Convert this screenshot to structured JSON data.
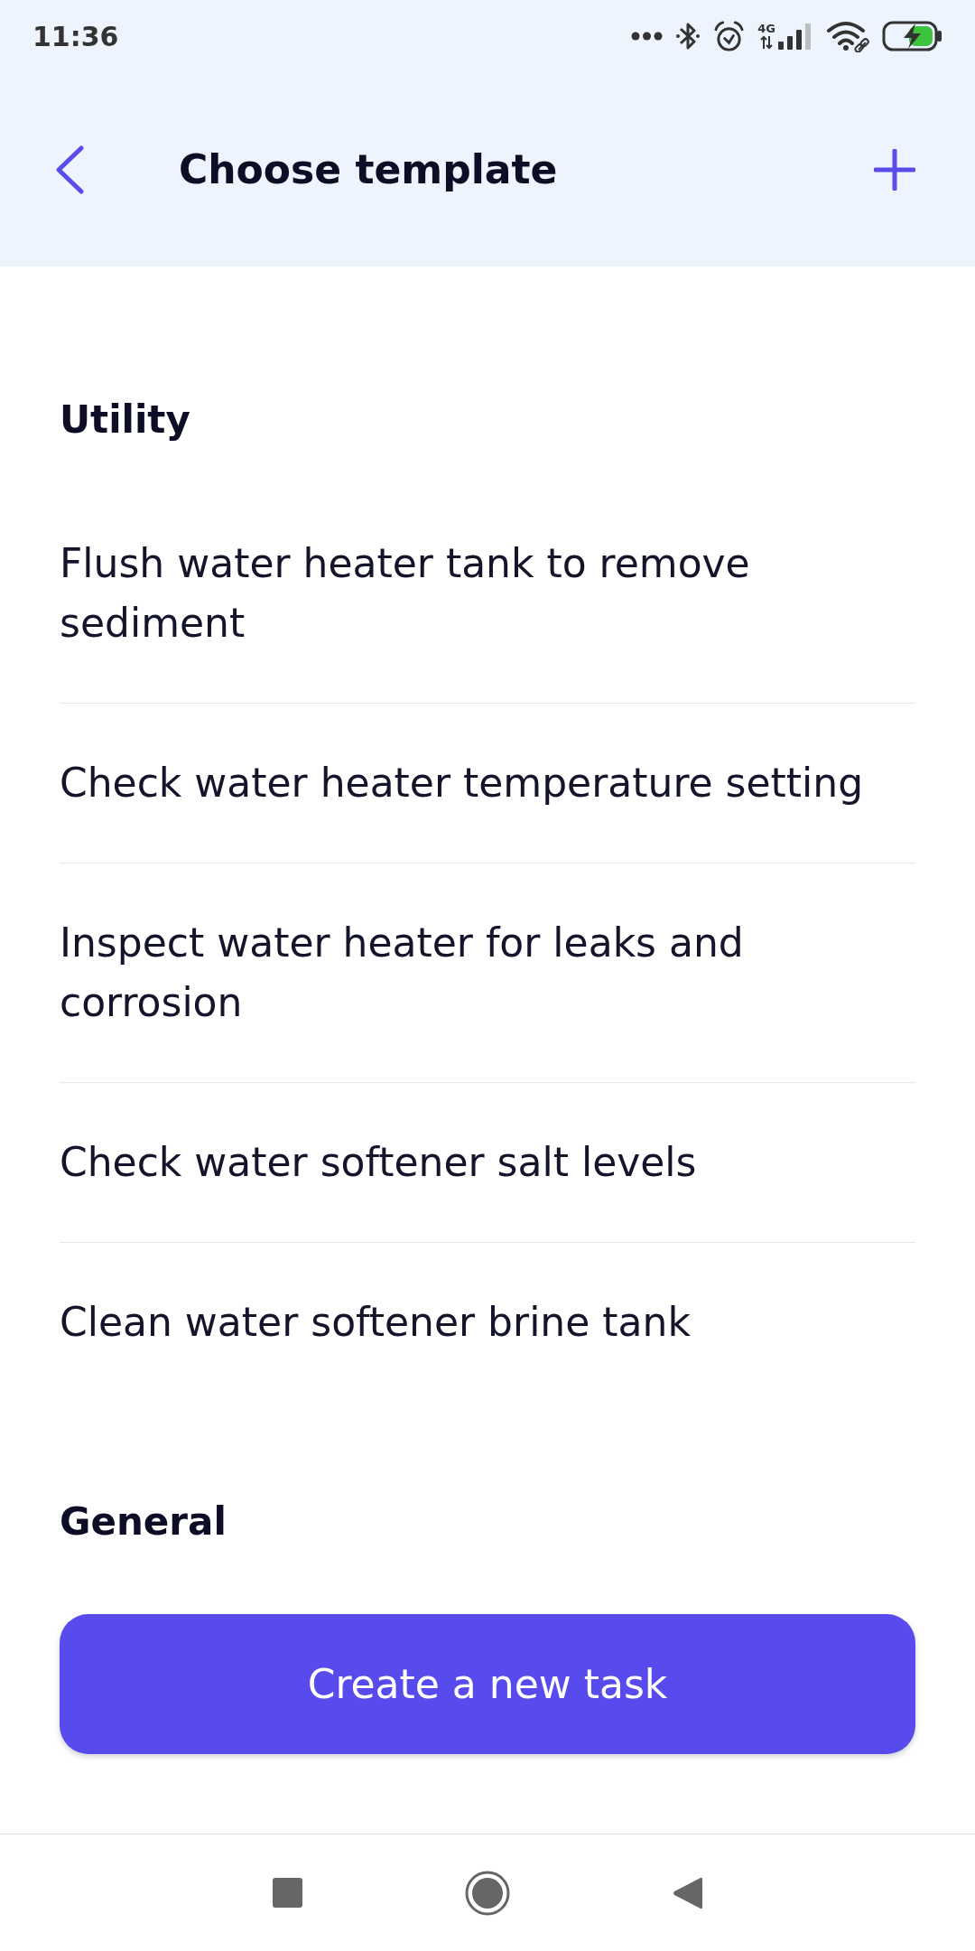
{
  "status_bar": {
    "time": "11:36",
    "network_type": "4G"
  },
  "header": {
    "title": "Choose template"
  },
  "sections": [
    {
      "title": "Utility",
      "items": [
        "Flush water heater tank to remove sediment",
        "Check water heater temperature setting",
        "Inspect water heater for leaks and corrosion",
        "Check water softener salt levels",
        "Clean water softener brine tank"
      ]
    },
    {
      "title": "General"
    }
  ],
  "button": {
    "label": "Create a new task"
  }
}
